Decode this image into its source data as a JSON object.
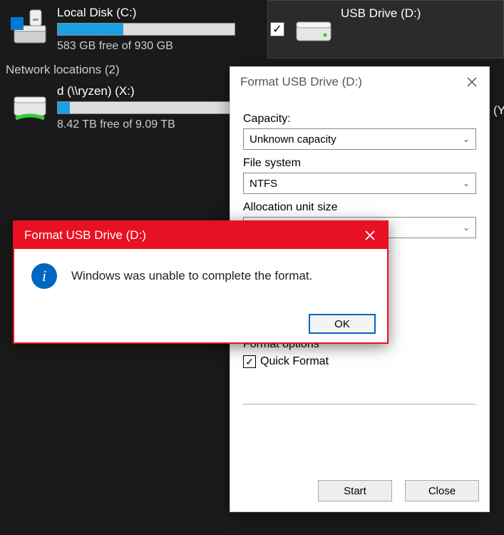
{
  "drives": {
    "local": {
      "name": "Local Disk (C:)",
      "free_text": "583 GB free of 930 GB",
      "fill_pct": 37
    },
    "usb": {
      "name": "USB Drive (D:)",
      "checked": true
    },
    "network_header": "Network locations (2)",
    "net": {
      "name": "d (\\\\ryzen) (X:)",
      "free_text": "8.42 TB free of 9.09 TB",
      "fill_pct": 7
    }
  },
  "format_dialog": {
    "title": "Format USB Drive (D:)",
    "capacity_label": "Capacity:",
    "capacity_value": "Unknown capacity",
    "fs_label": "File system",
    "fs_value": "NTFS",
    "au_label": "Allocation unit size",
    "au_value": "",
    "options_label": "Format options",
    "quick_label": "Quick Format",
    "quick_checked": true,
    "start": "Start",
    "close": "Close"
  },
  "error_dialog": {
    "title": "Format USB Drive (D:)",
    "message": "Windows was unable to complete the format.",
    "ok": "OK",
    "icon_glyph": "i"
  },
  "glyphs": {
    "check": "✓",
    "chevron": "⌄",
    "x": "✕"
  },
  "truncated": "(Y"
}
